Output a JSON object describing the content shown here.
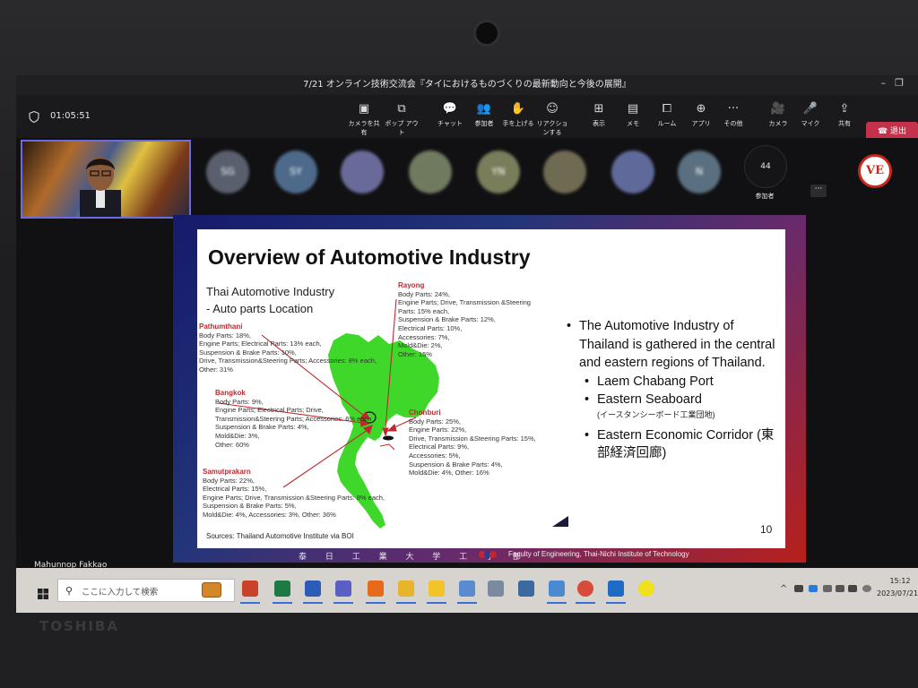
{
  "window": {
    "meeting_title": "7/21 オンライン技術交流会『タイにおけるものづくりの最新動向と今後の展開』",
    "timer": "01:05:51"
  },
  "toolbar": {
    "buttons": [
      {
        "label": "カメラを共有",
        "icon": "camera-share-icon",
        "glyph": "▣"
      },
      {
        "label": "ポップ アウト",
        "icon": "popout-icon",
        "glyph": "⧉"
      },
      {
        "label": "チャット",
        "icon": "chat-icon",
        "glyph": "💬"
      },
      {
        "label": "参加者",
        "icon": "people-icon",
        "glyph": "👥"
      },
      {
        "label": "手を上げる",
        "icon": "hand-icon",
        "glyph": "✋"
      },
      {
        "label": "リアクションする",
        "icon": "smile-icon",
        "glyph": "☺"
      },
      {
        "label": "表示",
        "icon": "grid-icon",
        "glyph": "⊞"
      },
      {
        "label": "メモ",
        "icon": "notes-icon",
        "glyph": "▤"
      },
      {
        "label": "ルーム",
        "icon": "rooms-icon",
        "glyph": "⧠"
      },
      {
        "label": "アプリ",
        "icon": "apps-icon",
        "glyph": "⊕"
      },
      {
        "label": "その他",
        "icon": "more-icon",
        "glyph": "···"
      },
      {
        "label": "カメラ",
        "icon": "camera-off-icon",
        "glyph": "🎥"
      },
      {
        "label": "マイク",
        "icon": "mic-off-icon",
        "glyph": "🎤"
      },
      {
        "label": "共有",
        "icon": "share-icon",
        "glyph": "⇪"
      }
    ],
    "leave_label": "退出"
  },
  "participants": {
    "avatars": [
      {
        "initials": "SG",
        "color": "#5a5f6e"
      },
      {
        "initials": "SY",
        "color": "#4d6a8a"
      },
      {
        "initials": "",
        "color": "#6a6a9a"
      },
      {
        "initials": "",
        "color": "#6f7a5e"
      },
      {
        "initials": "YN",
        "color": "#7a7d5a"
      },
      {
        "initials": "",
        "color": "#6f6a52"
      },
      {
        "initials": "",
        "color": "#5f6a9a"
      },
      {
        "initials": "N",
        "color": "#5a7080"
      }
    ],
    "count": "44",
    "count_label": "参加者",
    "presenter_name": "Mahunnop Fakkao",
    "logo_text": "VE"
  },
  "slide": {
    "title": "Overview of Automotive Industry",
    "subtitle_line1": "Thai Automotive Industry",
    "subtitle_line2": "- Auto parts Location",
    "regions": {
      "rayong": {
        "name": "Rayong",
        "lines": [
          "Body Parts: 24%,",
          "Engine Parts; Drive, Transmission &Steering",
          "Parts: 15% each,",
          "Suspension & Brake Parts: 12%,",
          "Electrical Parts: 10%,",
          "Accessories: 7%,",
          "Mold&Die: 2%,",
          "Other: 15%"
        ]
      },
      "pathumthani": {
        "name": "Pathumthani",
        "lines": [
          "Body Parts: 18%,",
          "Engine Parts; Electrical Parts: 13% each,",
          "Suspension & Brake Parts: 10%,",
          "Drive, Transmission&Steering Parts; Accessories: 8% each,",
          "Other: 31%"
        ]
      },
      "bangkok": {
        "name": "Bangkok",
        "lines": [
          "Body Parts: 9%,",
          "Engine Parts; Electrical Parts; Drive,",
          "Transmission&Steering Parts; Accessories: 6% each",
          "Suspension & Brake Parts: 4%,",
          "Mold&Die: 3%,",
          "Other: 60%"
        ]
      },
      "chonburi": {
        "name": "Chonburi",
        "lines": [
          "Body Parts: 25%,",
          "Engine Parts: 22%,",
          "Drive, Transmission &Steering Parts: 15%,",
          "Electrical Parts: 9%,",
          "Accessories: 5%,",
          "Suspension & Brake Parts: 4%,",
          "Mold&Die: 4%, Other: 16%"
        ]
      },
      "samutprakarn": {
        "name": "Samutprakarn",
        "lines": [
          "Body Parts: 22%,",
          "Electrical Parts: 15%,",
          "Engine Parts; Drive, Transmission &Steering Parts: 8% each,",
          "Suspension & Brake Parts: 5%,",
          "Mold&Die: 4%, Accessories: 3%, Other: 36%"
        ]
      }
    },
    "bullet_main": "The Automotive Industry of Thailand is gathered in the central and eastern regions of Thailand.",
    "sub_bullets": [
      "Laem Chabang Port",
      "Eastern Seaboard"
    ],
    "seaboard_jp": "(イースタンシーボード工業団地)",
    "corridor": "Eastern Economic Corridor (東部経済回廊)",
    "source": "Sources: Thailand Automotive Institute via BOI",
    "number": "10",
    "footer_jp": "泰 日 工 業 大 学 工 学 部",
    "footer_faculty": "Faculty of Engineering, Thai-Nichi Institute of Technology",
    "colors": {
      "map_green": "#3fd82a",
      "arrow": "#c0282e",
      "region_name": "#c0282e"
    }
  },
  "taskbar": {
    "search_placeholder": "ここに入力して検索",
    "apps": [
      {
        "name": "powerpoint-icon",
        "color": "#c9432a"
      },
      {
        "name": "excel-icon",
        "color": "#1e7a44"
      },
      {
        "name": "word-icon",
        "color": "#2b5cb8"
      },
      {
        "name": "teams-icon",
        "color": "#5a5fc4"
      },
      {
        "name": "firefox-icon",
        "color": "#e66a1a"
      },
      {
        "name": "file-explorer-icon",
        "color": "#e6b52a"
      },
      {
        "name": "sticky-notes-icon",
        "color": "#f2c42a"
      },
      {
        "name": "app-icon",
        "color": "#5a8ad0"
      },
      {
        "name": "app2-icon",
        "color": "#7a8aa0"
      },
      {
        "name": "calculator-icon",
        "color": "#3a6aa0"
      },
      {
        "name": "photos-icon",
        "color": "#4a8ad0"
      },
      {
        "name": "chrome-icon",
        "color": "#d84a3a"
      },
      {
        "name": "outlook-icon",
        "color": "#1f6ac4"
      },
      {
        "name": "yellow-app-icon",
        "color": "#f0e020"
      }
    ],
    "time": "15:12",
    "date": "2023/07/21"
  },
  "laptop": {
    "brand": "TOSHIBA"
  }
}
